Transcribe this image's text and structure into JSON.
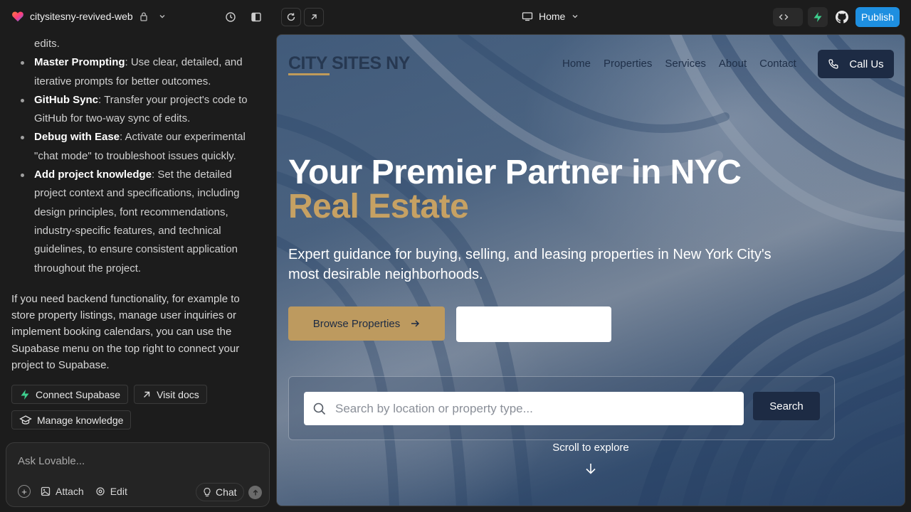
{
  "topbar": {
    "project_name": "citysitesny-revived-web",
    "page_selector": "Home",
    "publish_label": "Publish"
  },
  "chat": {
    "items": [
      {
        "bold": "",
        "text": "edits."
      },
      {
        "bold": "Master Prompting",
        "text": ": Use clear, detailed, and iterative prompts for better outcomes."
      },
      {
        "bold": "GitHub Sync",
        "text": ": Transfer your project's code to GitHub for two-way sync of edits."
      },
      {
        "bold": "Debug with Ease",
        "text": ": Activate our experimental \"chat mode\" to troubleshoot issues quickly."
      },
      {
        "bold": "Add project knowledge",
        "text": ": Set the detailed project context and specifications, including design principles, font recommendations, industry-specific features, and technical guidelines, to ensure consistent application throughout the project."
      }
    ],
    "paragraph": "If you need backend functionality, for example to store property listings, manage user inquiries or implement booking calendars, you can use the Supabase menu on the top right to connect your project to Supabase.",
    "actions": {
      "connect_supabase": "Connect Supabase",
      "visit_docs": "Visit docs",
      "manage_knowledge": "Manage knowledge"
    }
  },
  "composer": {
    "placeholder": "Ask Lovable...",
    "attach": "Attach",
    "edit": "Edit",
    "chat": "Chat"
  },
  "site": {
    "logo": "CITY SITES NY",
    "nav": [
      "Home",
      "Properties",
      "Services",
      "About",
      "Contact"
    ],
    "call_label": "Call Us",
    "headline_line1": "Your Premier Partner in NYC",
    "headline_line2": "Real Estate",
    "subtitle": "Expert guidance for buying, selling, and leasing properties in New York City's most desirable neighborhoods.",
    "browse_label": "Browse Properties",
    "search_placeholder": "Search by location or property type...",
    "search_button": "Search",
    "scroll_hint": "Scroll to explore"
  },
  "colors": {
    "publish": "#1e8fe0",
    "gold": "#c6a163",
    "navy": "#1d2b44",
    "supabase_green": "#3ecf8e"
  }
}
